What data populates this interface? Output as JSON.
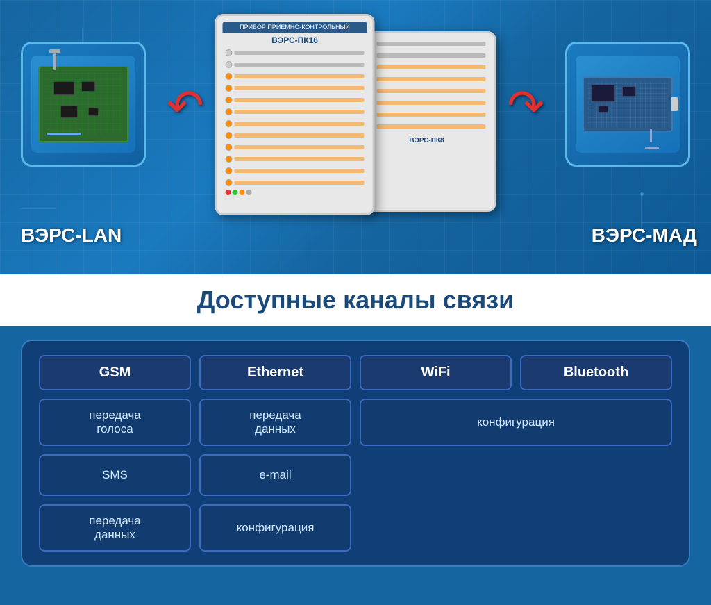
{
  "top": {
    "left_device_label": "ВЭРС-LAN",
    "right_device_label": "ВЭРС-МАД",
    "panel1_header": "ПРИБОР ПРИЁМНО-КОНТРОЛЬНЫЙ",
    "panel1_title": "ВЭРС-ПК16",
    "panel2_title": "ВЭРС-ПК8"
  },
  "section_title": "Доступные каналы связи",
  "channels": {
    "headers": [
      "GSM",
      "Ethernet",
      "WiFi",
      "Bluetooth"
    ],
    "gsm_items": [
      "передача\nголоса",
      "SMS",
      "передача\nданных"
    ],
    "ethernet_items": [
      "передача\nданных",
      "e-mail",
      "конфигурация"
    ],
    "wifi_bluetooth_items": [
      "конфигурация"
    ]
  }
}
